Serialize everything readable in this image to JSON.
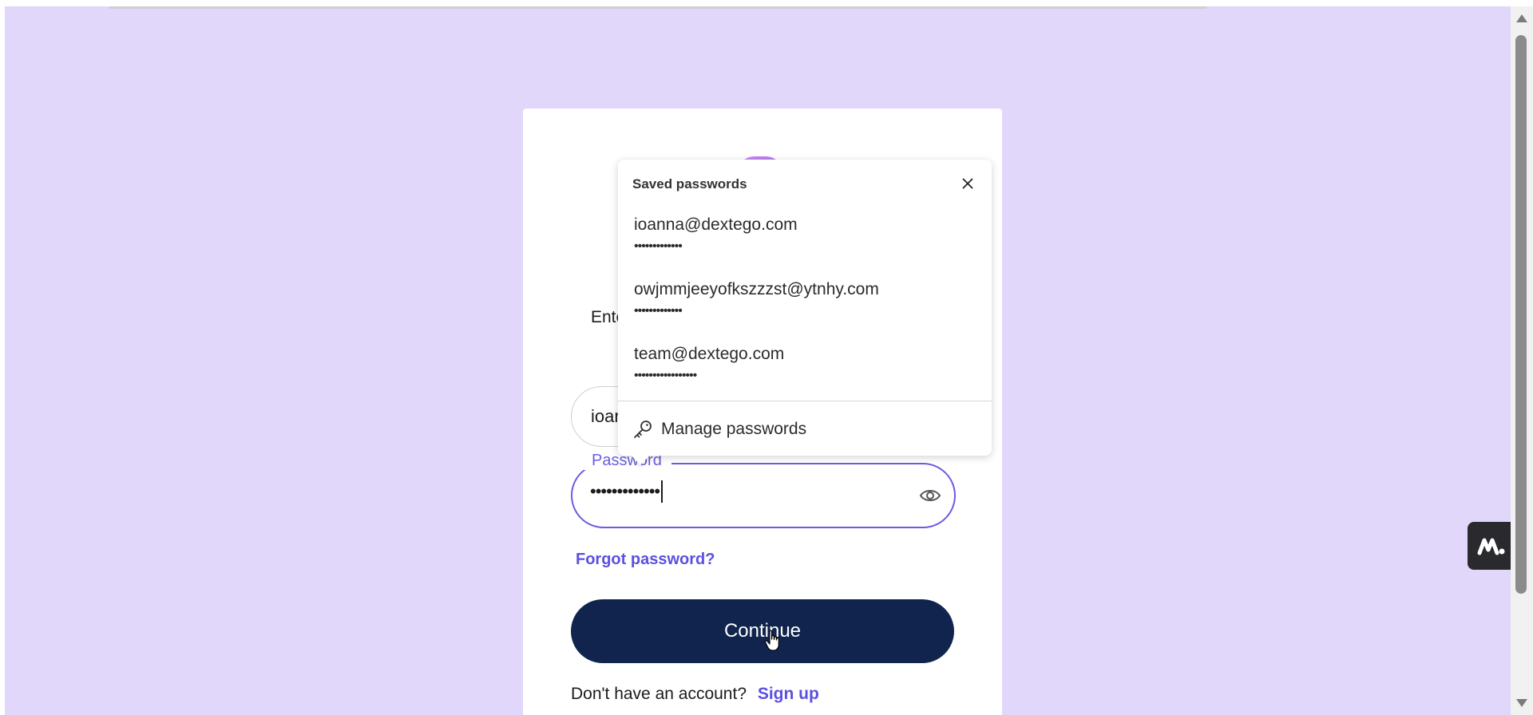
{
  "login": {
    "instruction_partial": "Ente",
    "email_value_partial": "ioar",
    "password_label": "Password",
    "password_value": "•••••••••••••",
    "forgot_link": "Forgot password?",
    "continue_button": "Continue",
    "signup_prompt": "Don't have an account?",
    "signup_link": "Sign up",
    "icons": {
      "show_password": "eye-icon"
    }
  },
  "saved_passwords_popup": {
    "title": "Saved passwords",
    "credentials": [
      {
        "username": "ioanna@dextego.com",
        "password_mask": "•••••••••••••"
      },
      {
        "username": "owjmmjeeyofkszzzst@ytnhy.com",
        "password_mask": "•••••••••••••"
      },
      {
        "username": "team@dextego.com",
        "password_mask": "•••••••••••••••••"
      }
    ],
    "manage_label": "Manage passwords",
    "icons": {
      "close": "close-icon",
      "manage": "key-icon"
    }
  },
  "colors": {
    "background": "#e1d7fb",
    "accent": "#5b4fe0",
    "button": "#10244d"
  }
}
